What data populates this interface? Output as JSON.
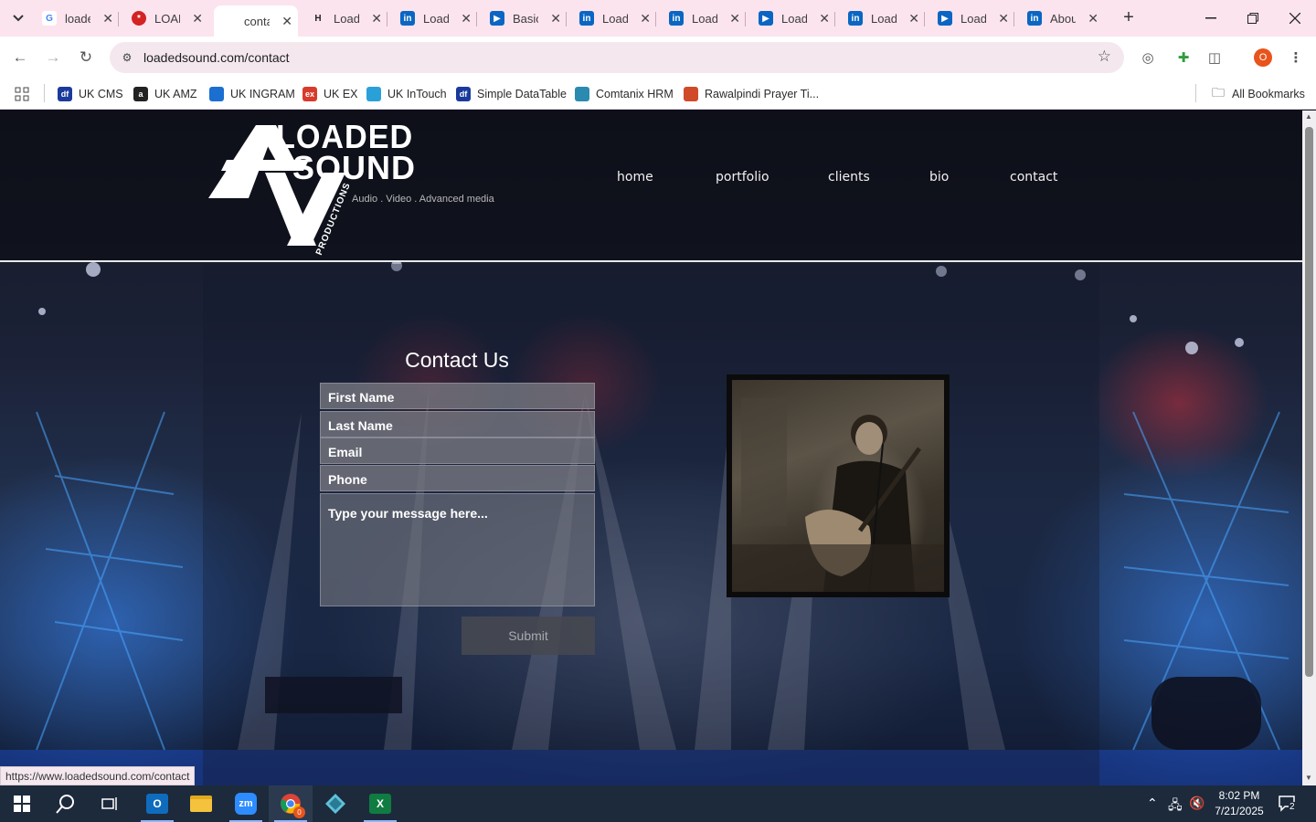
{
  "browser": {
    "tabs": [
      {
        "title": "loade",
        "icon": "google-icon",
        "color": "#4285f4",
        "active": false
      },
      {
        "title": "LOAD",
        "icon": "yelp-icon",
        "color": "#d32323",
        "active": false
      },
      {
        "title": "conta",
        "icon": "blank-icon",
        "color": "#ffffff",
        "active": true
      },
      {
        "title": "Loade",
        "icon": "h-icon",
        "color": "#222222",
        "active": false
      },
      {
        "title": "Loade",
        "icon": "linkedin-icon",
        "color": "#0a66c2",
        "active": false
      },
      {
        "title": "Basic",
        "icon": "video-icon",
        "color": "#0a66c2",
        "active": false
      },
      {
        "title": "Loade",
        "icon": "linkedin-icon",
        "color": "#0a66c2",
        "active": false
      },
      {
        "title": "Loade",
        "icon": "linkedin-icon",
        "color": "#0a66c2",
        "active": false
      },
      {
        "title": "Loade",
        "icon": "video-icon",
        "color": "#0a66c2",
        "active": false
      },
      {
        "title": "Loade",
        "icon": "linkedin-icon",
        "color": "#0a66c2",
        "active": false
      },
      {
        "title": "Loade",
        "icon": "video-icon",
        "color": "#0a66c2",
        "active": false
      },
      {
        "title": "Abou",
        "icon": "linkedin-icon",
        "color": "#0a66c2",
        "active": false
      }
    ],
    "url": "loadedsound.com/contact",
    "profile_initial": "O",
    "bookmarks": [
      {
        "label": "UK CMS",
        "icon": "df-icon",
        "color": "#1a3a9c"
      },
      {
        "label": "UK AMZ",
        "icon": "amazon-icon",
        "color": "#222222"
      },
      {
        "label": "UK INGRAM",
        "icon": "ingram-icon",
        "color": "#1a6fd0"
      },
      {
        "label": "UK EX",
        "icon": "ex-icon",
        "color": "#d83b2b"
      },
      {
        "label": "UK InTouch",
        "icon": "intouch-icon",
        "color": "#2aa0d8"
      },
      {
        "label": "Simple DataTable",
        "icon": "df-icon",
        "color": "#1a3a9c"
      },
      {
        "label": "Comtanix HRM",
        "icon": "comtanix-icon",
        "color": "#2a8ab0"
      },
      {
        "label": "Rawalpindi Prayer Ti...",
        "icon": "prayer-icon",
        "color": "#d04a2a"
      }
    ],
    "all_bookmarks_label": "All Bookmarks",
    "status_url": "https://www.loadedsound.com/contact"
  },
  "site": {
    "logo": {
      "line1": "LOADED",
      "line2": "SOUND",
      "tagline": "Audio . Video . Advanced media",
      "productions": "PRODUCTIONS"
    },
    "nav": [
      "home",
      "portfolio",
      "clients",
      "bio",
      "contact"
    ],
    "form": {
      "title": "Contact Us",
      "first_name": "First Name",
      "last_name": "Last Name",
      "email": "Email",
      "phone": "Phone",
      "message": "Type your message here...",
      "submit": "Submit"
    }
  },
  "taskbar": {
    "time": "8:02 PM",
    "date": "7/21/2025",
    "notifications": "2",
    "chrome_badge": "0"
  }
}
